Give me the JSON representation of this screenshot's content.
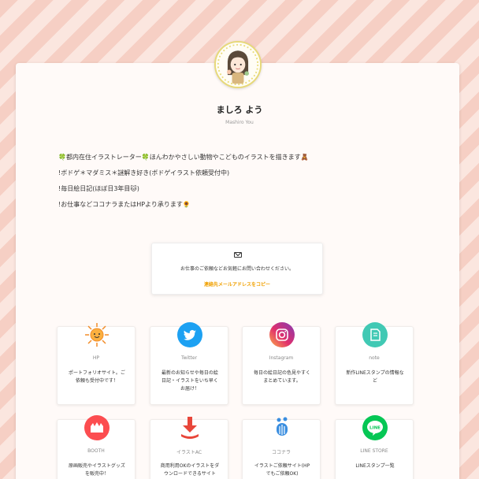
{
  "profile": {
    "name": "ましろ よう",
    "subname": "Mashiro You"
  },
  "bio": {
    "lines": [
      "🍀都内在住イラストレーター🍀ほんわかやさしい動物やこどものイラストを描きます🧸",
      "!ボドゲ＊マダミス＊謎解き好き(ボドゲイラスト依頼受付中)",
      "!毎日絵日記(ほぼ日3年目🐱)",
      "!お仕事などココナラまたはHPより承ります🌻"
    ]
  },
  "contact": {
    "icon": "mail-icon",
    "text": "お仕事のご依頼などお気軽にお問い合わせください。",
    "copy_label": "連絡先メールアドレスをコピー"
  },
  "links": [
    {
      "title": "HP",
      "desc": "ポートフォリオサイト。ご依頼も受付中です！",
      "icon": "sun-icon",
      "color": "#ffffff"
    },
    {
      "title": "Twitter",
      "desc": "最新のお知らせや毎日の絵日記・イラストをいち早くお届け！",
      "icon": "twitter-icon",
      "color": "#1da1f2"
    },
    {
      "title": "Instagram",
      "desc": "毎日の絵日記の色見やすくまとめています。",
      "icon": "instagram-icon",
      "color": "#d62976"
    },
    {
      "title": "note",
      "desc": "新作LINEスタンプの情報など",
      "icon": "note-icon",
      "color": "#41c9b4"
    },
    {
      "title": "BOOTH",
      "desc": "原画販売やイラストグッズを販売中！",
      "icon": "booth-icon",
      "color": "#fc4d50"
    },
    {
      "title": "イラストAC",
      "desc": "商用利用OKのイラストをダウンロードできるサイト",
      "icon": "download-icon",
      "color": "#ffffff"
    },
    {
      "title": "ココナラ",
      "desc": "イラストご依頼サイト(HPでもご依頼OK)",
      "icon": "coconala-icon",
      "color": "#ffffff"
    },
    {
      "title": "LINE STORE",
      "desc": "LINEスタンプ一覧",
      "icon": "line-icon",
      "color": "#06c755"
    }
  ]
}
